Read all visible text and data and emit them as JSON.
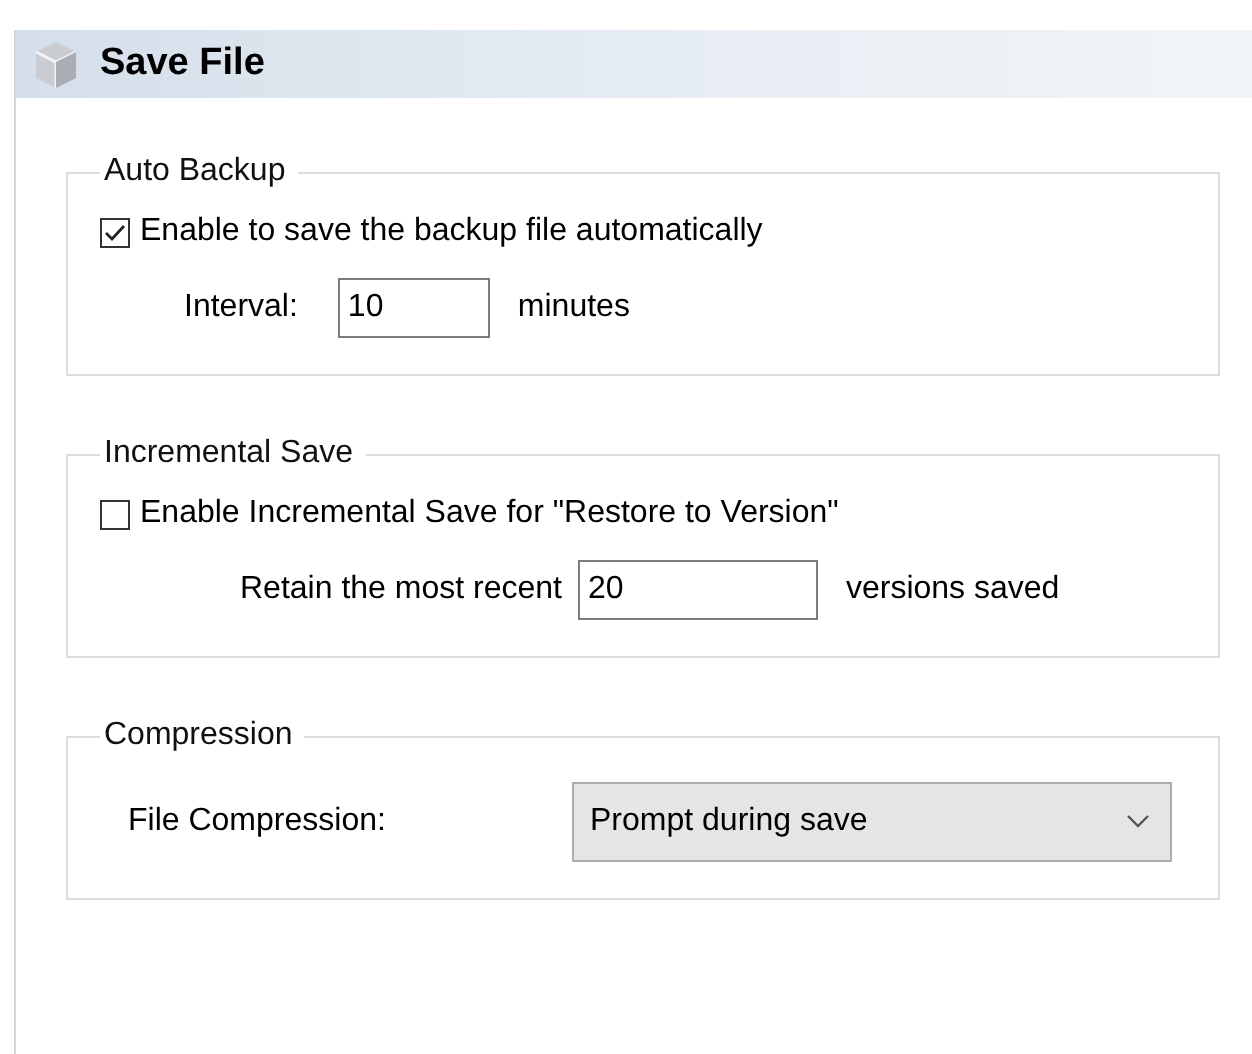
{
  "header": {
    "title": "Save File"
  },
  "groups": [
    {
      "kind": "checkbox",
      "title": "Auto Backup",
      "checkbox": {
        "label": "Enable to save the backup file automatically",
        "checked": true
      },
      "field": {
        "label": "Interval:",
        "value": "10",
        "unit": "minutes"
      }
    },
    {
      "kind": "checkbox",
      "title": "Incremental Save",
      "checkbox": {
        "label": "Enable Incremental Save for \"Restore to Version\"",
        "checked": false
      },
      "field": {
        "label": "Retain the most recent",
        "value": "20",
        "unit": "versions saved"
      }
    },
    {
      "kind": "dropdown",
      "title": "Compression",
      "label": "File Compression:",
      "value": "Prompt during save"
    }
  ]
}
